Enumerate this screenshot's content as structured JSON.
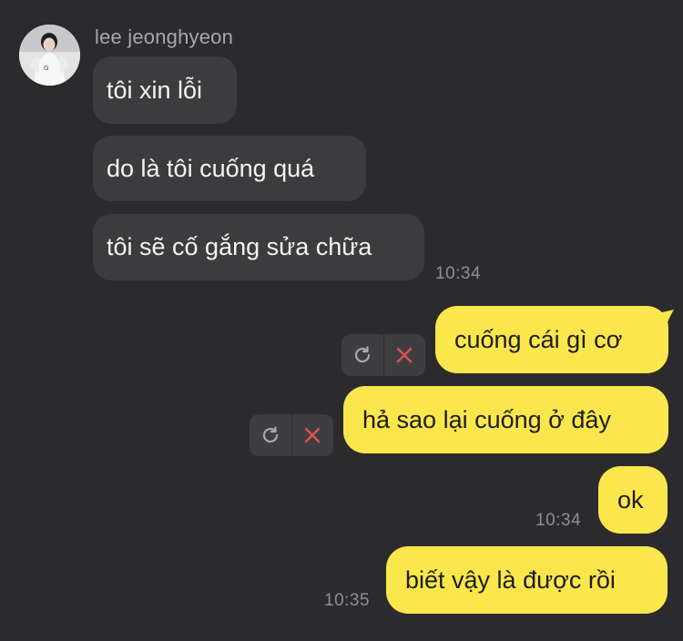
{
  "contact": {
    "name": "lee jeonghyeon",
    "avatar_icon": "profile-photo"
  },
  "incoming": [
    {
      "text": "tôi xin lỗi"
    },
    {
      "text": "do là tôi cuống quá"
    },
    {
      "text": "tôi sẽ cố gắng sửa chữa"
    }
  ],
  "incoming_time": "10:34",
  "outgoing": [
    {
      "text": "cuống cái gì cơ",
      "status": "failed"
    },
    {
      "text": "hả sao lại cuống ở đây",
      "status": "failed"
    },
    {
      "text": "ok",
      "time": "10:34"
    },
    {
      "text": "biết vậy là được rồi",
      "time": "10:35"
    }
  ],
  "actions": {
    "retry_icon": "retry-icon",
    "delete_icon": "close-icon"
  },
  "colors": {
    "background": "#2b2b2d",
    "incoming_bubble": "#3c3c3e",
    "outgoing_bubble": "#fbe74c",
    "delete_red": "#e0524f"
  }
}
